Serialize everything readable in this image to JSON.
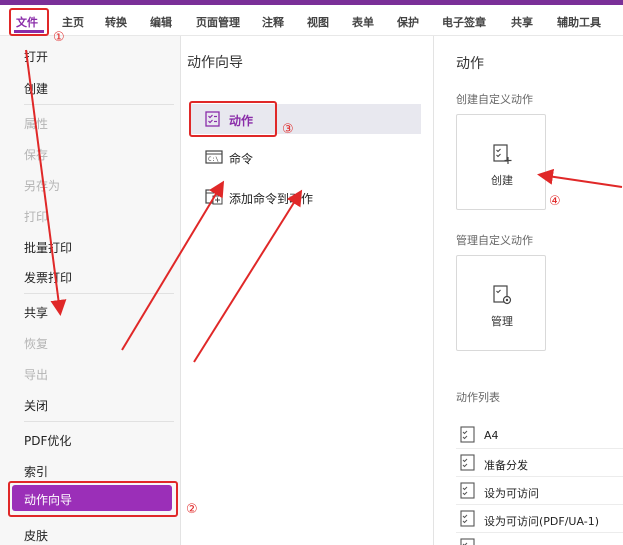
{
  "ribbon": {
    "tabs": [
      "文件",
      "主页",
      "转换",
      "编辑",
      "页面管理",
      "注释",
      "视图",
      "表单",
      "保护",
      "电子签章",
      "共享",
      "辅助工具"
    ],
    "accent_color": "#8a2da9"
  },
  "left_menu": {
    "items": [
      "打开",
      "创建",
      "属性",
      "保存",
      "另存为",
      "打印",
      "批量打印",
      "发票打印",
      "共享",
      "恢复",
      "导出",
      "关闭",
      "PDF优化",
      "索引",
      "动作向导",
      "皮肤"
    ],
    "active_item": "动作向导"
  },
  "middle_panel": {
    "title": "动作向导",
    "options": [
      "动作",
      "命令",
      "添加命令到动作"
    ],
    "selected": "动作"
  },
  "right_panel": {
    "title": "动作",
    "create_section": "创建自定义动作",
    "create_label": "创建",
    "manage_section": "管理自定义动作",
    "manage_label": "管理",
    "list_section": "动作列表",
    "list_items": [
      "A4",
      "准备分发",
      "设为可访问",
      "设为可访问(PDF/UA-1)"
    ]
  },
  "annotations": {
    "marks": [
      "①",
      "②",
      "③",
      "④"
    ],
    "color": "#e02828"
  }
}
